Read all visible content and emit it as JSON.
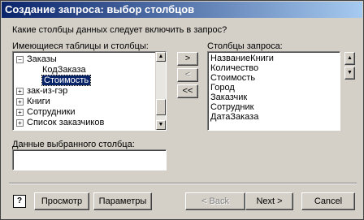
{
  "window": {
    "title": "Создание запроса: выбор столбцов"
  },
  "prompt": "Какие столбцы данных следует включить в запрос?",
  "available": {
    "label": "Имеющиеся таблицы и столбцы:",
    "items": [
      {
        "text": "Заказы",
        "expander": "−",
        "indent": 0
      },
      {
        "text": "КодЗаказа",
        "expander": "",
        "indent": 1
      },
      {
        "text": "Стоимость",
        "expander": "",
        "indent": 1,
        "selected": true
      },
      {
        "text": "зак-из-гэр",
        "expander": "+",
        "indent": 0
      },
      {
        "text": "Книги",
        "expander": "+",
        "indent": 0
      },
      {
        "text": "Сотрудники",
        "expander": "+",
        "indent": 0
      },
      {
        "text": "Список заказчиков",
        "expander": "+",
        "indent": 0
      }
    ]
  },
  "move_buttons": {
    "add": ">",
    "remove": "<",
    "remove_all": "<<"
  },
  "query_columns": {
    "label": "Столбцы запроса:",
    "items": [
      "НазваниеКниги",
      "Количество",
      "Стоимость",
      "Город",
      "Заказчик",
      "Сотрудник",
      "ДатаЗаказа"
    ]
  },
  "order_buttons": {
    "up": "▲",
    "down": "▼"
  },
  "selected_data": {
    "label": "Данные выбранного столбца:",
    "value": ""
  },
  "footer": {
    "help": "?",
    "preview": "Просмотр",
    "options": "Параметры",
    "back": "< Back",
    "next": "Next >",
    "cancel": "Cancel"
  }
}
